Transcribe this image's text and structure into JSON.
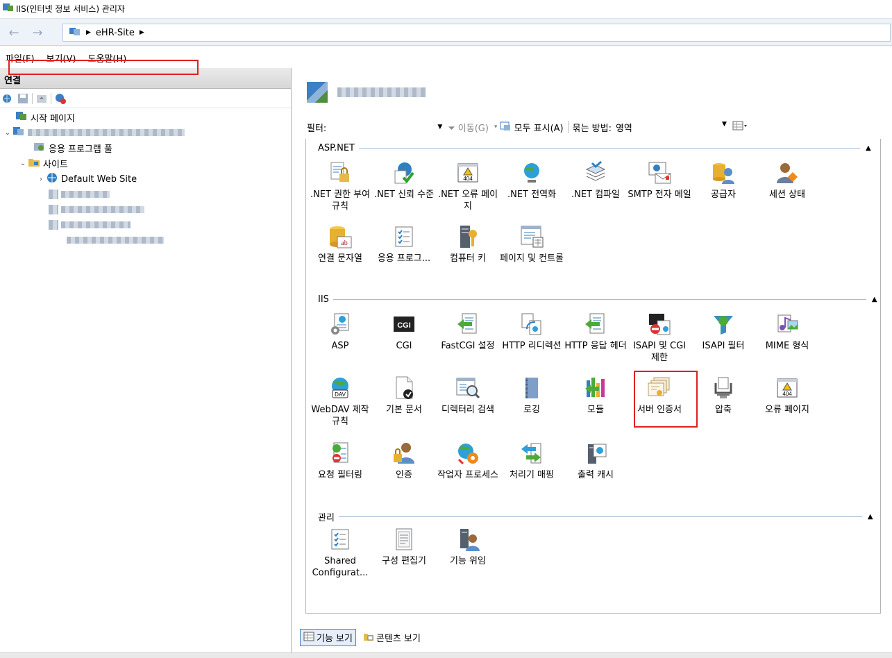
{
  "window": {
    "title": "IIS(인터넷 정보 서비스) 관리자"
  },
  "address": {
    "crumbs": [
      "eHR-Site"
    ]
  },
  "menu": {
    "items": [
      "파일(F)",
      "보기(V)",
      "도움말(H)"
    ]
  },
  "connections": {
    "title": "연결",
    "tree": {
      "start_page": "시작 페이지",
      "app_pools": "응용 프로그램 풀",
      "sites": "사이트",
      "default_site": "Default Web Site"
    }
  },
  "filterbar": {
    "filter_label": "필터:",
    "go_label": "이동(G)",
    "show_all_label": "모두 표시(A)",
    "group_by_label": "묶는 방법:",
    "group_by_value": "영역"
  },
  "groups": {
    "aspnet": {
      "title": "ASP.NET",
      "items": [
        ".NET 권한 부여 규칙",
        ".NET 신뢰 수준",
        ".NET 오류 페이지",
        ".NET 전역화",
        ".NET 컴파일",
        "SMTP 전자 메일",
        "공급자",
        "세션 상태",
        "연결 문자열",
        "응용 프로그...",
        "컴퓨터 키",
        "페이지 및 컨트롤"
      ]
    },
    "iis": {
      "title": "IIS",
      "items": [
        "ASP",
        "CGI",
        "FastCGI 설정",
        "HTTP 리디렉션",
        "HTTP 응답 헤더",
        "ISAPI 및 CGI 제한",
        "ISAPI 필터",
        "MIME 형식",
        "WebDAV 제작 규칙",
        "기본 문서",
        "디렉터리 검색",
        "로깅",
        "모듈",
        "서버 인증서",
        "압축",
        "오류 페이지",
        "요청 필터링",
        "인증",
        "작업자 프로세스",
        "처리기 매핑",
        "출력 캐시"
      ]
    },
    "management": {
      "title": "관리",
      "items": [
        "Shared Configurat...",
        "구성 편집기",
        "기능 위임"
      ]
    }
  },
  "icon_labels": {
    "cgi": "CGI",
    "error_code": "404",
    "webdav": "DAV",
    "dot_code": "ab"
  },
  "bottom_tabs": {
    "features_view": "기능 보기",
    "content_view": "콘텐츠 보기"
  },
  "colors": {
    "highlight": "#e02020",
    "group_line": "#a9b9d4",
    "accent": "#1f5fa8"
  }
}
